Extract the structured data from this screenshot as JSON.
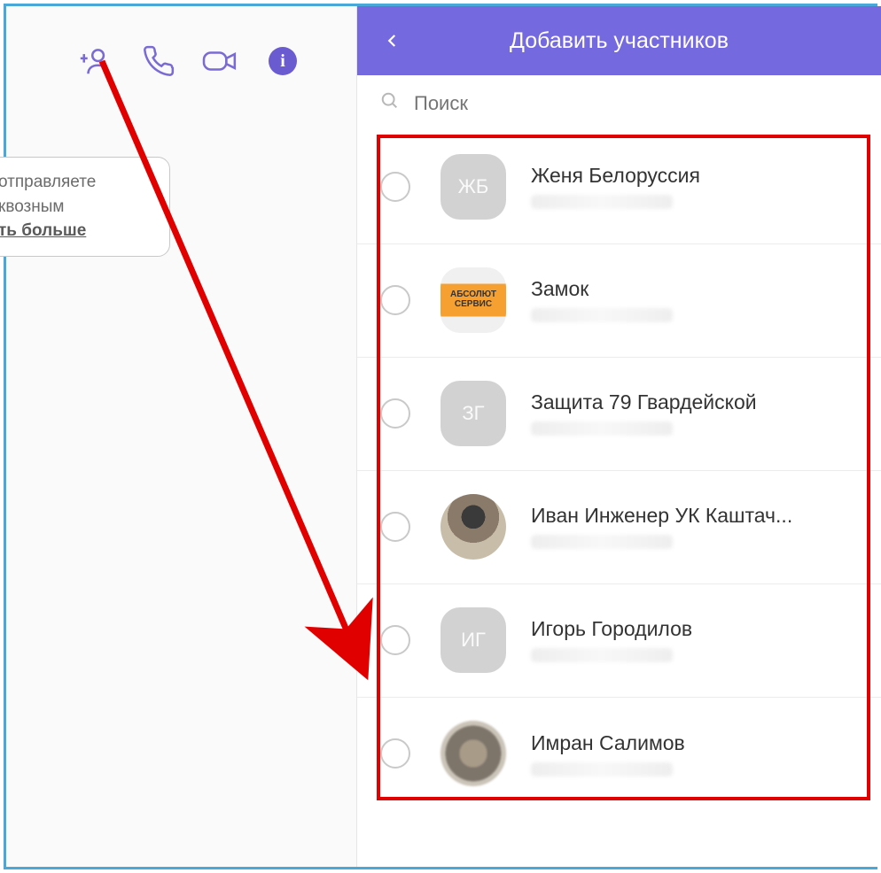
{
  "toolbar": {
    "add_contact": "add-contact",
    "voice_call": "voice-call",
    "video_call": "video-call",
    "info": "info"
  },
  "bubble": {
    "line1": "отправляете",
    "line2": "квозным",
    "more": "ть больше"
  },
  "header": {
    "title": "Добавить участников"
  },
  "search": {
    "placeholder": "Поиск"
  },
  "contacts": [
    {
      "name": "Женя Белоруссия",
      "avatar_type": "initials",
      "initials": "ЖБ"
    },
    {
      "name": "Замок",
      "avatar_type": "logo",
      "logo_top": "АБСОЛЮТ",
      "logo_bot": "СЕРВИС"
    },
    {
      "name": "Защита 79 Гвардейской",
      "avatar_type": "initials",
      "initials": "ЗГ"
    },
    {
      "name": "Иван Инженер УК Каштач...",
      "avatar_type": "photo"
    },
    {
      "name": "Игорь Городилов",
      "avatar_type": "initials",
      "initials": "ИГ"
    },
    {
      "name": "Имран Салимов",
      "avatar_type": "photo2"
    }
  ],
  "colors": {
    "accent": "#7569df",
    "highlight": "#e10000",
    "frame": "#4aa8d8"
  }
}
